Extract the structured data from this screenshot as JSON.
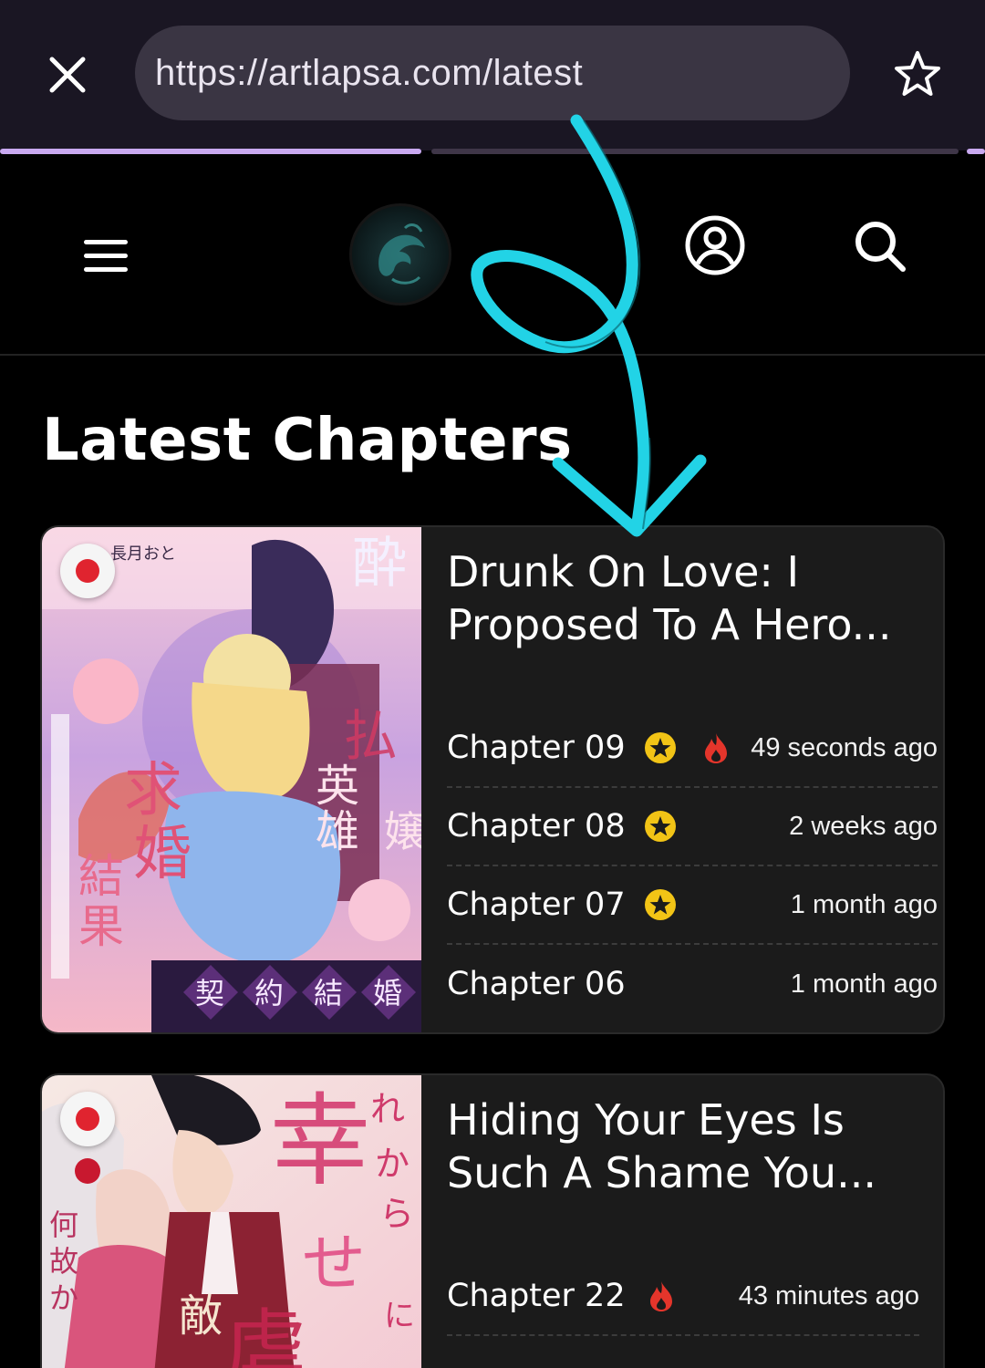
{
  "browser": {
    "url": "https://artlapsa.com/latest"
  },
  "page": {
    "title": "Latest Chapters"
  },
  "colors": {
    "browser_bar": "#1a1623",
    "url_pill": "#3a3543",
    "progress": "#c9a9f0",
    "card_bg": "#1b1b1b",
    "star_badge": "#f2c416",
    "fire": "#e4352b",
    "annotation": "#22d3e6"
  },
  "series": [
    {
      "title": "Drunk On Love: I Proposed To A Hero...",
      "cover_text": [
        "酔っ払い令嬢が",
        "英雄と知らず",
        "求婚した結果",
        "契約結婚"
      ],
      "chapters": [
        {
          "name": "Chapter 09",
          "star": true,
          "fire": true,
          "time": "49 seconds ago"
        },
        {
          "name": "Chapter 08",
          "star": true,
          "fire": false,
          "time": "2 weeks ago"
        },
        {
          "name": "Chapter 07",
          "star": true,
          "fire": false,
          "time": "1 month ago"
        },
        {
          "name": "Chapter 06",
          "star": false,
          "fire": false,
          "time": "1 month ago"
        }
      ]
    },
    {
      "title": "Hiding Your Eyes Is Such A Shame You...",
      "cover_text": [
        "これから",
        "幸せに",
        "虐",
        "敵対",
        "何故か"
      ],
      "chapters": [
        {
          "name": "Chapter 22",
          "star": false,
          "fire": true,
          "time": "43 minutes ago"
        }
      ]
    }
  ]
}
